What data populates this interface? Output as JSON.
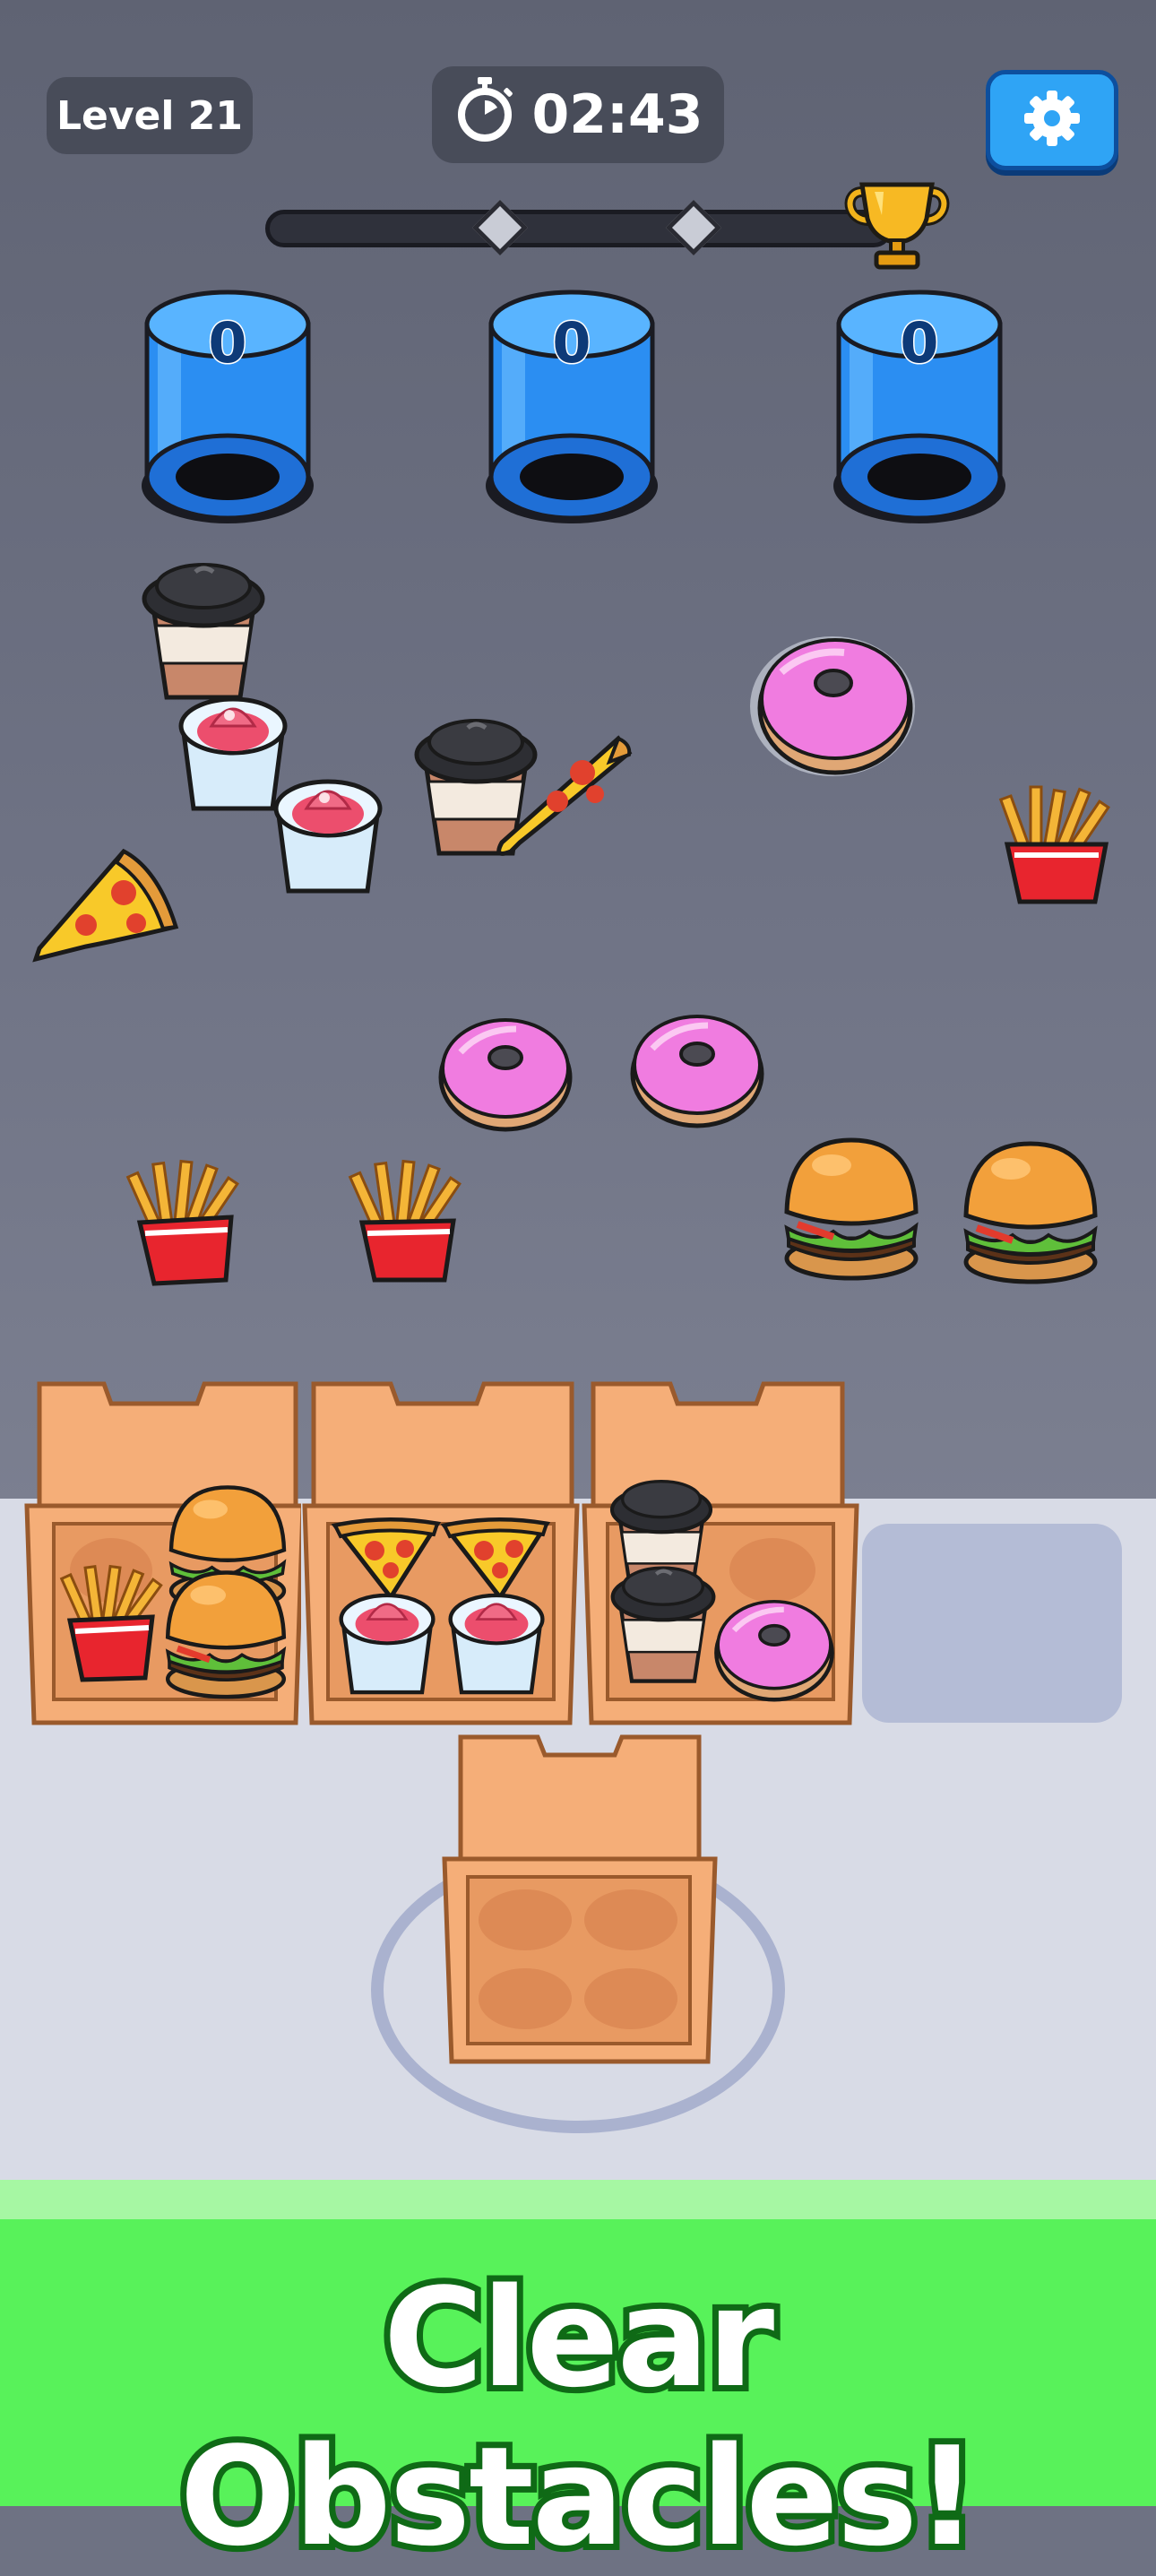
{
  "hud": {
    "level_label": "Level 21",
    "timer_text": "02:43",
    "progress_fraction": 0.0
  },
  "counters": [
    {
      "value": "0"
    },
    {
      "value": "0"
    },
    {
      "value": "0"
    }
  ],
  "board_items": [
    "coffee-cup",
    "ice-cream-cup",
    "ice-cream-cup",
    "coffee-cup",
    "pizza-slice",
    "pizza-slice",
    "donut",
    "fries",
    "donut",
    "donut",
    "fries",
    "fries",
    "burger",
    "burger"
  ],
  "boxes": [
    {
      "contents": [
        "fries",
        "burger",
        "burger"
      ]
    },
    {
      "contents": [
        "pizza-slice",
        "pizza-slice",
        "ice-cream-cup",
        "ice-cream-cup"
      ]
    },
    {
      "contents": [
        "coffee-cup",
        "coffee-cup",
        "donut"
      ]
    }
  ],
  "banner": {
    "text": "Clear Obstacles!"
  },
  "colors": {
    "accent": "#2fa4f5",
    "banner": "#58f25a",
    "tube": "#2a8af0"
  }
}
